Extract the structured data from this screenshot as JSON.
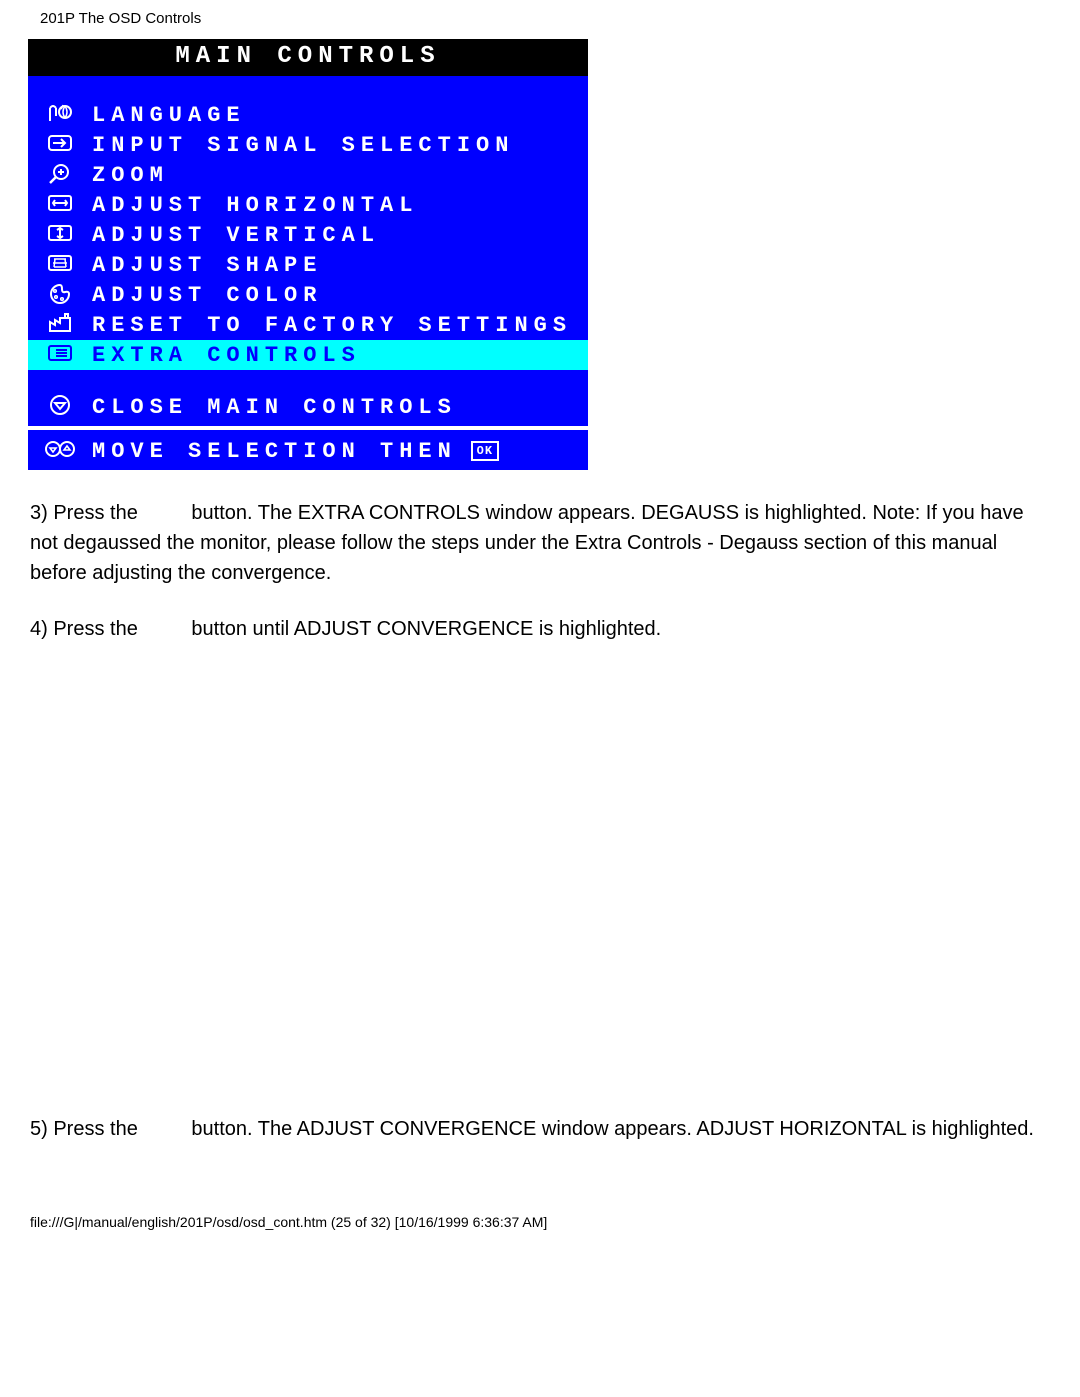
{
  "header": "201P The OSD Controls",
  "osd": {
    "title": "MAIN CONTROLS",
    "items": [
      {
        "name": "language",
        "label": "LANGUAGE",
        "icon": "language-icon",
        "highlighted": false
      },
      {
        "name": "input-signal",
        "label": "INPUT SIGNAL SELECTION",
        "icon": "arrow-right-icon",
        "highlighted": false
      },
      {
        "name": "zoom",
        "label": "ZOOM",
        "icon": "magnifier-icon",
        "highlighted": false
      },
      {
        "name": "adjust-horizontal",
        "label": "ADJUST HORIZONTAL",
        "icon": "horiz-icon",
        "highlighted": false
      },
      {
        "name": "adjust-vertical",
        "label": "ADJUST VERTICAL",
        "icon": "vert-icon",
        "highlighted": false
      },
      {
        "name": "adjust-shape",
        "label": "ADJUST SHAPE",
        "icon": "shape-icon",
        "highlighted": false
      },
      {
        "name": "adjust-color",
        "label": "ADJUST COLOR",
        "icon": "palette-icon",
        "highlighted": false
      },
      {
        "name": "reset-factory",
        "label": "RESET TO FACTORY SETTINGS",
        "icon": "factory-icon",
        "highlighted": false
      },
      {
        "name": "extra-controls",
        "label": "EXTRA CONTROLS",
        "icon": "list-icon",
        "highlighted": true
      }
    ],
    "close": {
      "label": "CLOSE MAIN CONTROLS",
      "icon": "down-circle-icon"
    },
    "hint": {
      "label": "MOVE SELECTION THEN",
      "icon": "updown-circles-icon",
      "ok_label": "OK"
    }
  },
  "paragraphs": {
    "p3_lead": "3) Press the",
    "p3_rest": "button. The EXTRA CONTROLS window appears. DEGAUSS is highlighted. Note: If you have not degaussed the monitor, please follow the steps under the Extra Controls - Degauss section of this manual before adjusting the convergence.",
    "p4_lead": "4) Press the",
    "p4_rest": "button until ADJUST CONVERGENCE is highlighted.",
    "p5_lead": "5) Press the",
    "p5_rest": "button. The ADJUST CONVERGENCE window appears. ADJUST HORIZONTAL is highlighted."
  },
  "footer": "file:///G|/manual/english/201P/osd/osd_cont.htm (25 of 32) [10/16/1999 6:36:37 AM]"
}
